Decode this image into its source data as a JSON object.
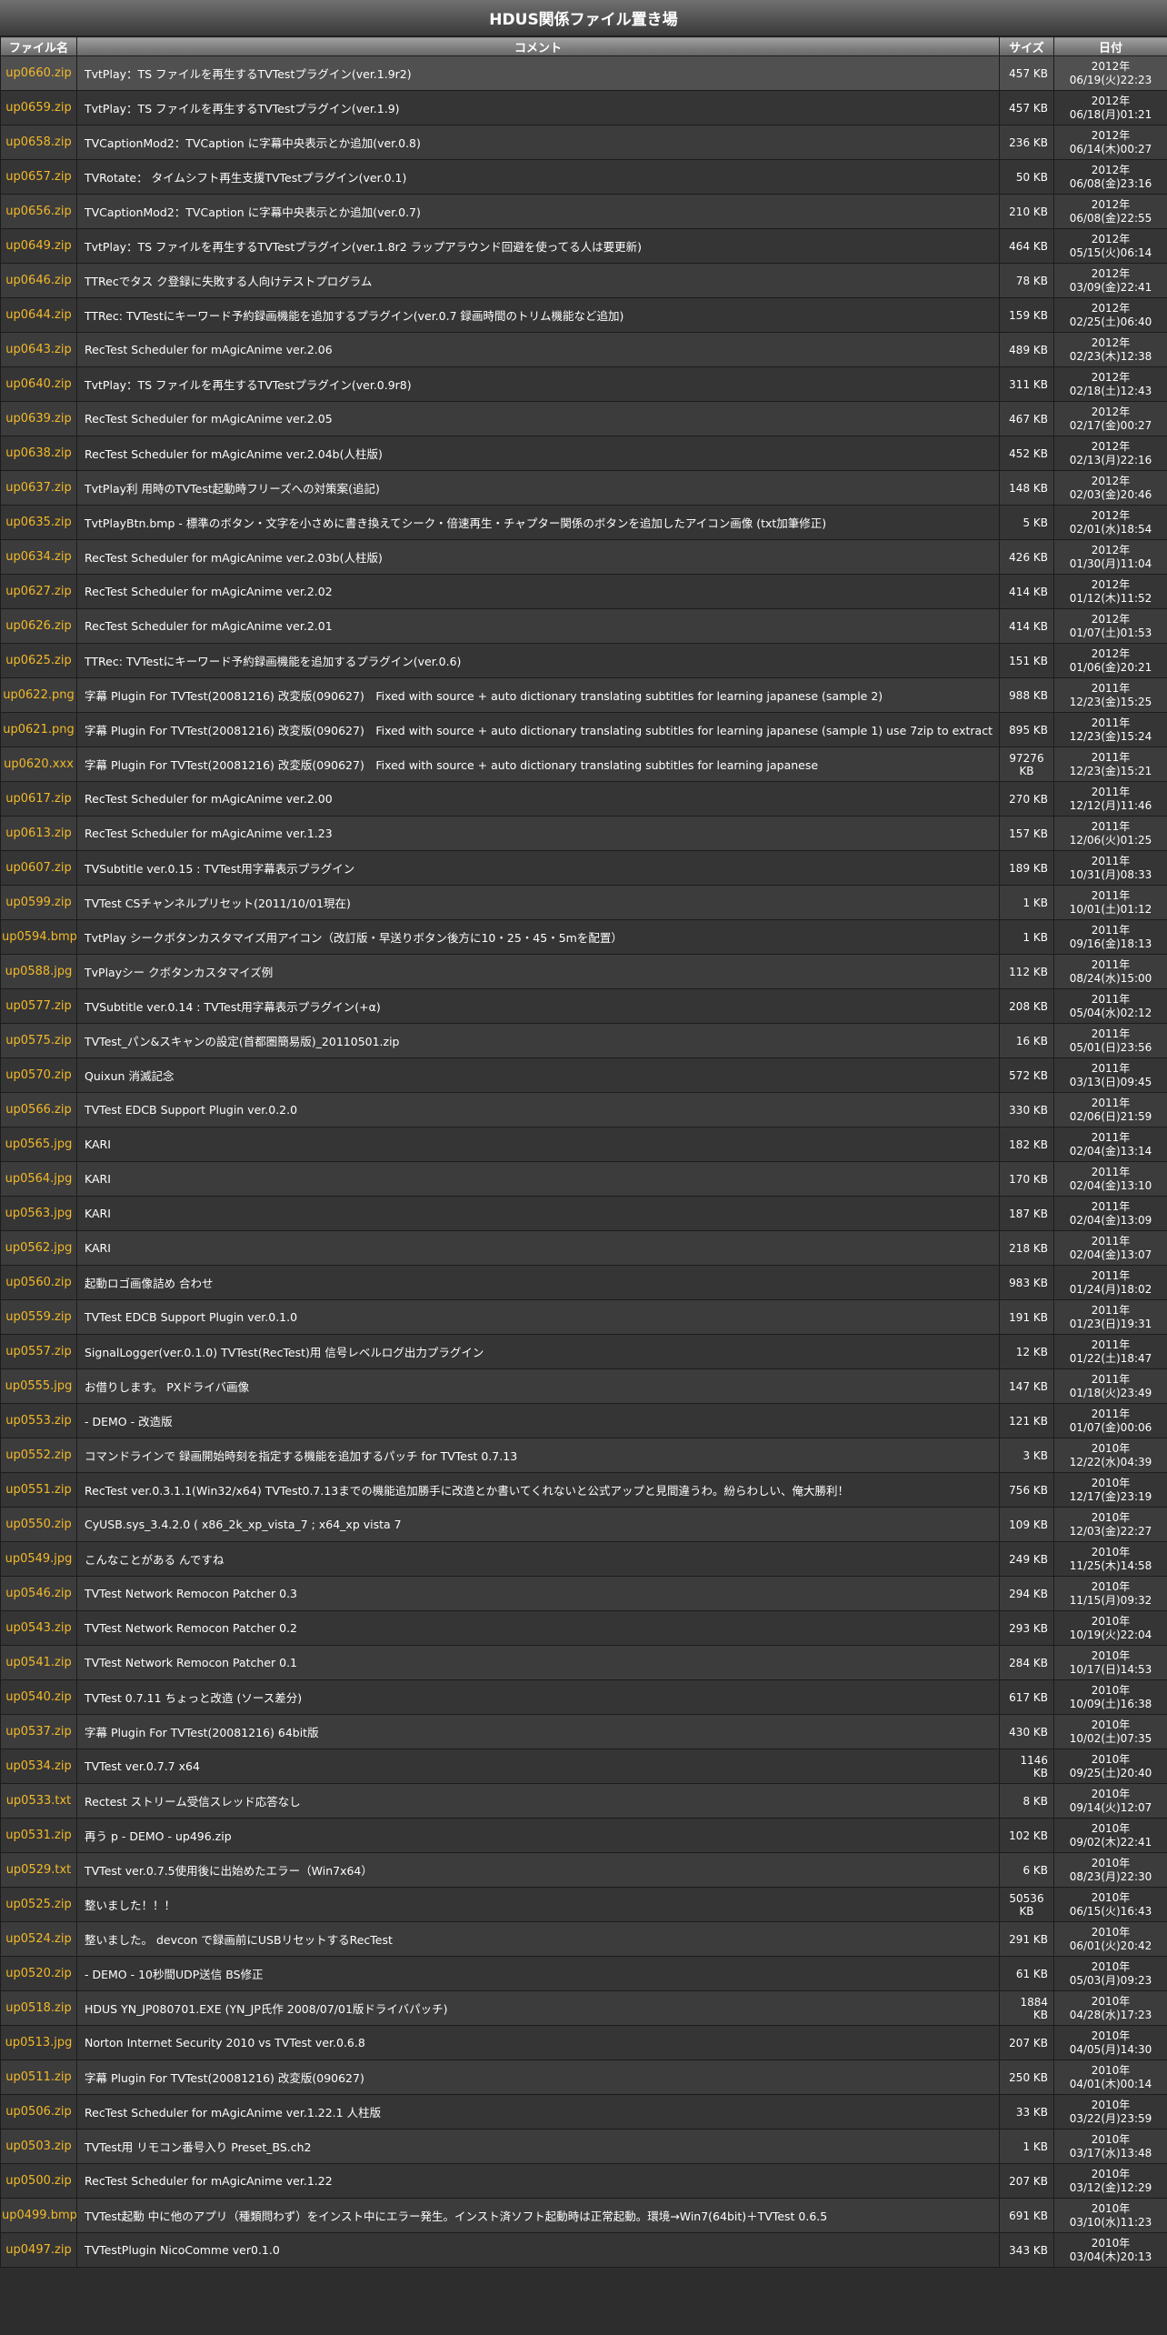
{
  "page_title": "HDUS関係ファイル置き場",
  "columns": [
    "ファイル名",
    "コメント",
    "サイズ",
    "日付"
  ],
  "files": [
    {
      "name": "up0660.zip",
      "comment": "TvtPlay：TS ファイルを再生するTVTestプラグイン(ver.1.9r2)",
      "size": "457 KB",
      "year": "2012年",
      "date": "06/19(火)22:23"
    },
    {
      "name": "up0659.zip",
      "comment": "TvtPlay：TS ファイルを再生するTVTestプラグイン(ver.1.9)",
      "size": "457 KB",
      "year": "2012年",
      "date": "06/18(月)01:21"
    },
    {
      "name": "up0658.zip",
      "comment": "TVCaptionMod2：TVCaption に字幕中央表示とか追加(ver.0.8)",
      "size": "236 KB",
      "year": "2012年",
      "date": "06/14(木)00:27"
    },
    {
      "name": "up0657.zip",
      "comment": "TVRotate： タイムシフト再生支援TVTestプラグイン(ver.0.1)",
      "size": "50 KB",
      "year": "2012年",
      "date": "06/08(金)23:16"
    },
    {
      "name": "up0656.zip",
      "comment": "TVCaptionMod2：TVCaption に字幕中央表示とか追加(ver.0.7)",
      "size": "210 KB",
      "year": "2012年",
      "date": "06/08(金)22:55"
    },
    {
      "name": "up0649.zip",
      "comment": "TvtPlay：TS ファイルを再生するTVTestプラグイン(ver.1.8r2 ラップアラウンド回避を使ってる人は要更新)",
      "size": "464 KB",
      "year": "2012年",
      "date": "05/15(火)06:14"
    },
    {
      "name": "up0646.zip",
      "comment": "TTRecでタス ク登録に失敗する人向けテストプログラム",
      "size": "78 KB",
      "year": "2012年",
      "date": "03/09(金)22:41"
    },
    {
      "name": "up0644.zip",
      "comment": "TTRec: TVTestにキーワード予約録画機能を追加するプラグイン(ver.0.7 録画時間のトリム機能など追加)",
      "size": "159 KB",
      "year": "2012年",
      "date": "02/25(土)06:40"
    },
    {
      "name": "up0643.zip",
      "comment": "RecTest Scheduler for mAgicAnime ver.2.06",
      "size": "489 KB",
      "year": "2012年",
      "date": "02/23(木)12:38"
    },
    {
      "name": "up0640.zip",
      "comment": "TvtPlay：TS ファイルを再生するTVTestプラグイン(ver.0.9r8)",
      "size": "311 KB",
      "year": "2012年",
      "date": "02/18(土)12:43"
    },
    {
      "name": "up0639.zip",
      "comment": "RecTest Scheduler for mAgicAnime ver.2.05",
      "size": "467 KB",
      "year": "2012年",
      "date": "02/17(金)00:27"
    },
    {
      "name": "up0638.zip",
      "comment": "RecTest Scheduler for mAgicAnime ver.2.04b(人柱版)",
      "size": "452 KB",
      "year": "2012年",
      "date": "02/13(月)22:16"
    },
    {
      "name": "up0637.zip",
      "comment": "TvtPlay利 用時のTVTest起動時フリーズへの対策案(追記)",
      "size": "148 KB",
      "year": "2012年",
      "date": "02/03(金)20:46"
    },
    {
      "name": "up0635.zip",
      "comment": "TvtPlayBtn.bmp - 標準のボタン・文字を小さめに書き換えてシーク・倍速再生・チャプター関係のボタンを追加したアイコン画像 (txt加筆修正)",
      "size": "5 KB",
      "year": "2012年",
      "date": "02/01(水)18:54"
    },
    {
      "name": "up0634.zip",
      "comment": "RecTest Scheduler for mAgicAnime ver.2.03b(人柱版)",
      "size": "426 KB",
      "year": "2012年",
      "date": "01/30(月)11:04"
    },
    {
      "name": "up0627.zip",
      "comment": "RecTest Scheduler for mAgicAnime ver.2.02",
      "size": "414 KB",
      "year": "2012年",
      "date": "01/12(木)11:52"
    },
    {
      "name": "up0626.zip",
      "comment": "RecTest Scheduler for mAgicAnime ver.2.01",
      "size": "414 KB",
      "year": "2012年",
      "date": "01/07(土)01:53"
    },
    {
      "name": "up0625.zip",
      "comment": "TTRec: TVTestにキーワード予約録画機能を追加するプラグイン(ver.0.6)",
      "size": "151 KB",
      "year": "2012年",
      "date": "01/06(金)20:21"
    },
    {
      "name": "up0622.png",
      "comment": "字幕 Plugin For TVTest(20081216) 改変版(090627)　Fixed with source + auto dictionary translating subtitles for learning japanese (sample 2)",
      "size": "988 KB",
      "year": "2011年",
      "date": "12/23(金)15:25"
    },
    {
      "name": "up0621.png",
      "comment": "字幕 Plugin For TVTest(20081216) 改変版(090627)　Fixed with source + auto dictionary translating subtitles for learning japanese (sample 1) use 7zip to extract",
      "size": "895 KB",
      "year": "2011年",
      "date": "12/23(金)15:24"
    },
    {
      "name": "up0620.xxx",
      "comment": "字幕 Plugin For TVTest(20081216) 改変版(090627)　Fixed with source + auto dictionary translating subtitles for learning japanese",
      "size": "97276 KB",
      "year": "2011年",
      "date": "12/23(金)15:21"
    },
    {
      "name": "up0617.zip",
      "comment": "RecTest Scheduler for mAgicAnime ver.2.00",
      "size": "270 KB",
      "year": "2011年",
      "date": "12/12(月)11:46"
    },
    {
      "name": "up0613.zip",
      "comment": "RecTest Scheduler for mAgicAnime ver.1.23",
      "size": "157 KB",
      "year": "2011年",
      "date": "12/06(火)01:25"
    },
    {
      "name": "up0607.zip",
      "comment": "TVSubtitle ver.0.15 : TVTest用字幕表示プラグイン",
      "size": "189 KB",
      "year": "2011年",
      "date": "10/31(月)08:33"
    },
    {
      "name": "up0599.zip",
      "comment": "TVTest CSチャンネルプリセット(2011/10/01現在)",
      "size": "1 KB",
      "year": "2011年",
      "date": "10/01(土)01:12"
    },
    {
      "name": "up0594.bmp",
      "comment": "TvtPlay シークボタンカスタマイズ用アイコン（改訂版・早送りボタン後方に10・25・45・5mを配置）",
      "size": "1 KB",
      "year": "2011年",
      "date": "09/16(金)18:13"
    },
    {
      "name": "up0588.jpg",
      "comment": "TvPlayシー クボタンカスタマイズ例",
      "size": "112 KB",
      "year": "2011年",
      "date": "08/24(水)15:00"
    },
    {
      "name": "up0577.zip",
      "comment": "TVSubtitle ver.0.14 : TVTest用字幕表示プラグイン(+α)",
      "size": "208 KB",
      "year": "2011年",
      "date": "05/04(水)02:12"
    },
    {
      "name": "up0575.zip",
      "comment": "TVTest_パン&スキャンの設定(首都圏簡易版)_20110501.zip",
      "size": "16 KB",
      "year": "2011年",
      "date": "05/01(日)23:56"
    },
    {
      "name": "up0570.zip",
      "comment": "Quixun 消滅記念",
      "size": "572 KB",
      "year": "2011年",
      "date": "03/13(日)09:45"
    },
    {
      "name": "up0566.zip",
      "comment": "TVTest EDCB Support Plugin ver.0.2.0",
      "size": "330 KB",
      "year": "2011年",
      "date": "02/06(日)21:59"
    },
    {
      "name": "up0565.jpg",
      "comment": "KARI",
      "size": "182 KB",
      "year": "2011年",
      "date": "02/04(金)13:14"
    },
    {
      "name": "up0564.jpg",
      "comment": "KARI",
      "size": "170 KB",
      "year": "2011年",
      "date": "02/04(金)13:10"
    },
    {
      "name": "up0563.jpg",
      "comment": "KARI",
      "size": "187 KB",
      "year": "2011年",
      "date": "02/04(金)13:09"
    },
    {
      "name": "up0562.jpg",
      "comment": "KARI",
      "size": "218 KB",
      "year": "2011年",
      "date": "02/04(金)13:07"
    },
    {
      "name": "up0560.zip",
      "comment": "起動ロゴ画像詰め 合わせ",
      "size": "983 KB",
      "year": "2011年",
      "date": "01/24(月)18:02"
    },
    {
      "name": "up0559.zip",
      "comment": "TVTest EDCB Support Plugin ver.0.1.0",
      "size": "191 KB",
      "year": "2011年",
      "date": "01/23(日)19:31"
    },
    {
      "name": "up0557.zip",
      "comment": " SignalLogger(ver.0.1.0) TVTest(RecTest)用 信号レベルログ出力プラグイン",
      "size": "12 KB",
      "year": "2011年",
      "date": "01/22(土)18:47"
    },
    {
      "name": "up0555.jpg",
      "comment": "お借りします。 PXドライバ画像",
      "size": "147 KB",
      "year": "2011年",
      "date": "01/18(火)23:49"
    },
    {
      "name": "up0553.zip",
      "comment": "- DEMO - 改造版",
      "size": "121 KB",
      "year": "2011年",
      "date": "01/07(金)00:06"
    },
    {
      "name": "up0552.zip",
      "comment": "コマンドラインで 録画開始時刻を指定する機能を追加するパッチ for TVTest 0.7.13",
      "size": "3 KB",
      "year": "2010年",
      "date": "12/22(水)04:39"
    },
    {
      "name": "up0551.zip",
      "comment": "RecTest ver.0.3.1.1(Win32/x64) TVTest0.7.13までの機能追加勝手に改造とか書いてくれないと公式アップと見間違うわ。紛らわしい、俺大勝利！",
      "size": "756 KB",
      "year": "2010年",
      "date": "12/17(金)23:19"
    },
    {
      "name": "up0550.zip",
      "comment": "CyUSB.sys_3.4.2.0 ( x86_2k_xp_vista_7 ; x64_xp vista 7",
      "size": "109 KB",
      "year": "2010年",
      "date": "12/03(金)22:27"
    },
    {
      "name": "up0549.jpg",
      "comment": "こんなことがある んですね",
      "size": "249 KB",
      "year": "2010年",
      "date": "11/25(木)14:58"
    },
    {
      "name": "up0546.zip",
      "comment": "TVTest Network Remocon Patcher 0.3",
      "size": "294 KB",
      "year": "2010年",
      "date": "11/15(月)09:32"
    },
    {
      "name": "up0543.zip",
      "comment": "TVTest Network Remocon Patcher 0.2",
      "size": "293 KB",
      "year": "2010年",
      "date": "10/19(火)22:04"
    },
    {
      "name": "up0541.zip",
      "comment": "TVTest Network Remocon Patcher 0.1",
      "size": "284 KB",
      "year": "2010年",
      "date": "10/17(日)14:53"
    },
    {
      "name": "up0540.zip",
      "comment": "TVTest 0.7.11 ちょっと改造 (ソース差分)",
      "size": "617 KB",
      "year": "2010年",
      "date": "10/09(土)16:38"
    },
    {
      "name": "up0537.zip",
      "comment": "字幕 Plugin For TVTest(20081216) 64bit版",
      "size": "430 KB",
      "year": "2010年",
      "date": "10/02(土)07:35"
    },
    {
      "name": "up0534.zip",
      "comment": "TVTest ver.0.7.7 x64",
      "size": "1146 KB",
      "year": "2010年",
      "date": "09/25(土)20:40"
    },
    {
      "name": "up0533.txt",
      "comment": "Rectest ストリーム受信スレッド応答なし",
      "size": "8 KB",
      "year": "2010年",
      "date": "09/14(火)12:07"
    },
    {
      "name": "up0531.zip",
      "comment": " 再う p - DEMO - up496.zip",
      "size": "102 KB",
      "year": "2010年",
      "date": "09/02(木)22:41"
    },
    {
      "name": "up0529.txt",
      "comment": "TVTest ver.0.7.5使用後に出始めたエラー（Win7x64）",
      "size": "6 KB",
      "year": "2010年",
      "date": "08/23(月)22:30"
    },
    {
      "name": "up0525.zip",
      "comment": "整いました！！！",
      "size": "50536 KB",
      "year": "2010年",
      "date": "06/15(火)16:43"
    },
    {
      "name": "up0524.zip",
      "comment": "整いました。 devcon で録画前にUSBリセットするRecTest",
      "size": "291 KB",
      "year": "2010年",
      "date": "06/01(火)20:42"
    },
    {
      "name": "up0520.zip",
      "comment": "- DEMO - 10秒間UDP送信 BS修正",
      "size": "61 KB",
      "year": "2010年",
      "date": "05/03(月)09:23"
    },
    {
      "name": "up0518.zip",
      "comment": "HDUS YN_JP080701.EXE (YN_JP氏作 2008/07/01版ドライバパッチ)",
      "size": "1884 KB",
      "year": "2010年",
      "date": "04/28(水)17:23"
    },
    {
      "name": "up0513.jpg",
      "comment": "Norton Internet Security 2010 vs TVTest ver.0.6.8",
      "size": "207 KB",
      "year": "2010年",
      "date": "04/05(月)14:30"
    },
    {
      "name": "up0511.zip",
      "comment": "字幕 Plugin For TVTest(20081216) 改変版(090627)",
      "size": "250 KB",
      "year": "2010年",
      "date": "04/01(木)00:14"
    },
    {
      "name": "up0506.zip",
      "comment": "RecTest Scheduler for mAgicAnime ver.1.22.1 人柱版",
      "size": "33 KB",
      "year": "2010年",
      "date": "03/22(月)23:59"
    },
    {
      "name": "up0503.zip",
      "comment": "TVTest用 リモコン番号入り Preset_BS.ch2",
      "size": "1 KB",
      "year": "2010年",
      "date": "03/17(水)13:48"
    },
    {
      "name": "up0500.zip",
      "comment": "RecTest Scheduler for mAgicAnime ver.1.22",
      "size": "207 KB",
      "year": "2010年",
      "date": "03/12(金)12:29"
    },
    {
      "name": "up0499.bmp",
      "comment": "TVTest起動 中に他のアプリ（種類問わず）をインスト中にエラー発生。インスト済ソフト起動時は正常起動。環境→Win7(64bit)＋TVTest 0.6.5",
      "size": "691 KB",
      "year": "2010年",
      "date": "03/10(水)11:23"
    },
    {
      "name": "up0497.zip",
      "comment": "TVTestPlugin NicoComme ver0.1.0",
      "size": "343 KB",
      "year": "2010年",
      "date": "03/04(木)20:13"
    }
  ]
}
